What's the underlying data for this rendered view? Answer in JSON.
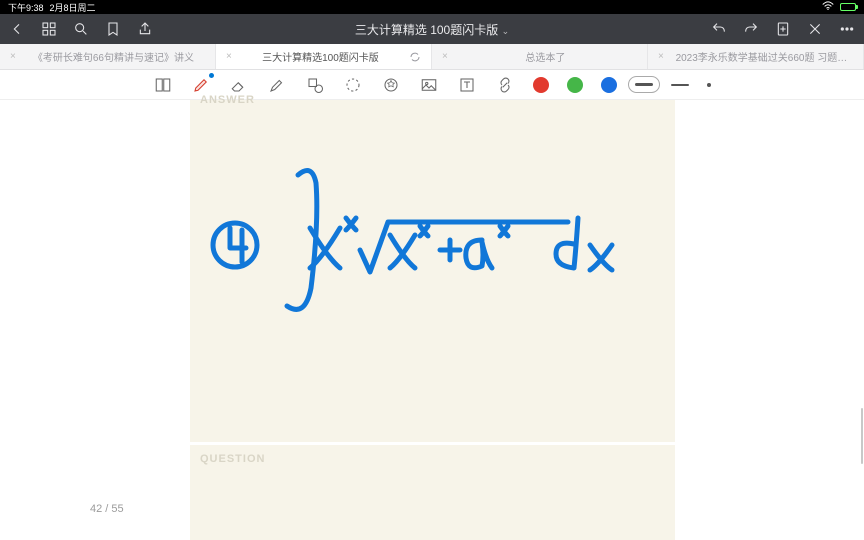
{
  "status": {
    "time": "下午9:38",
    "date": "2月8日周二"
  },
  "nav": {
    "title": "三大计算精选 100题闪卡版"
  },
  "tabs": [
    {
      "label": "《考研长难句66句精讲与速记》讲义"
    },
    {
      "label": "三大计算精选100题闪卡版"
    },
    {
      "label": "总选本了"
    },
    {
      "label": "2023李永乐数学基础过关660题 习题…"
    }
  ],
  "cards": {
    "answer_label": "ANSWER",
    "question_label": "QUESTION"
  },
  "page": {
    "counter": "42 / 55"
  },
  "colors": {
    "red": "#e23a2e",
    "green": "#45b648",
    "blue": "#1a6fe0"
  }
}
